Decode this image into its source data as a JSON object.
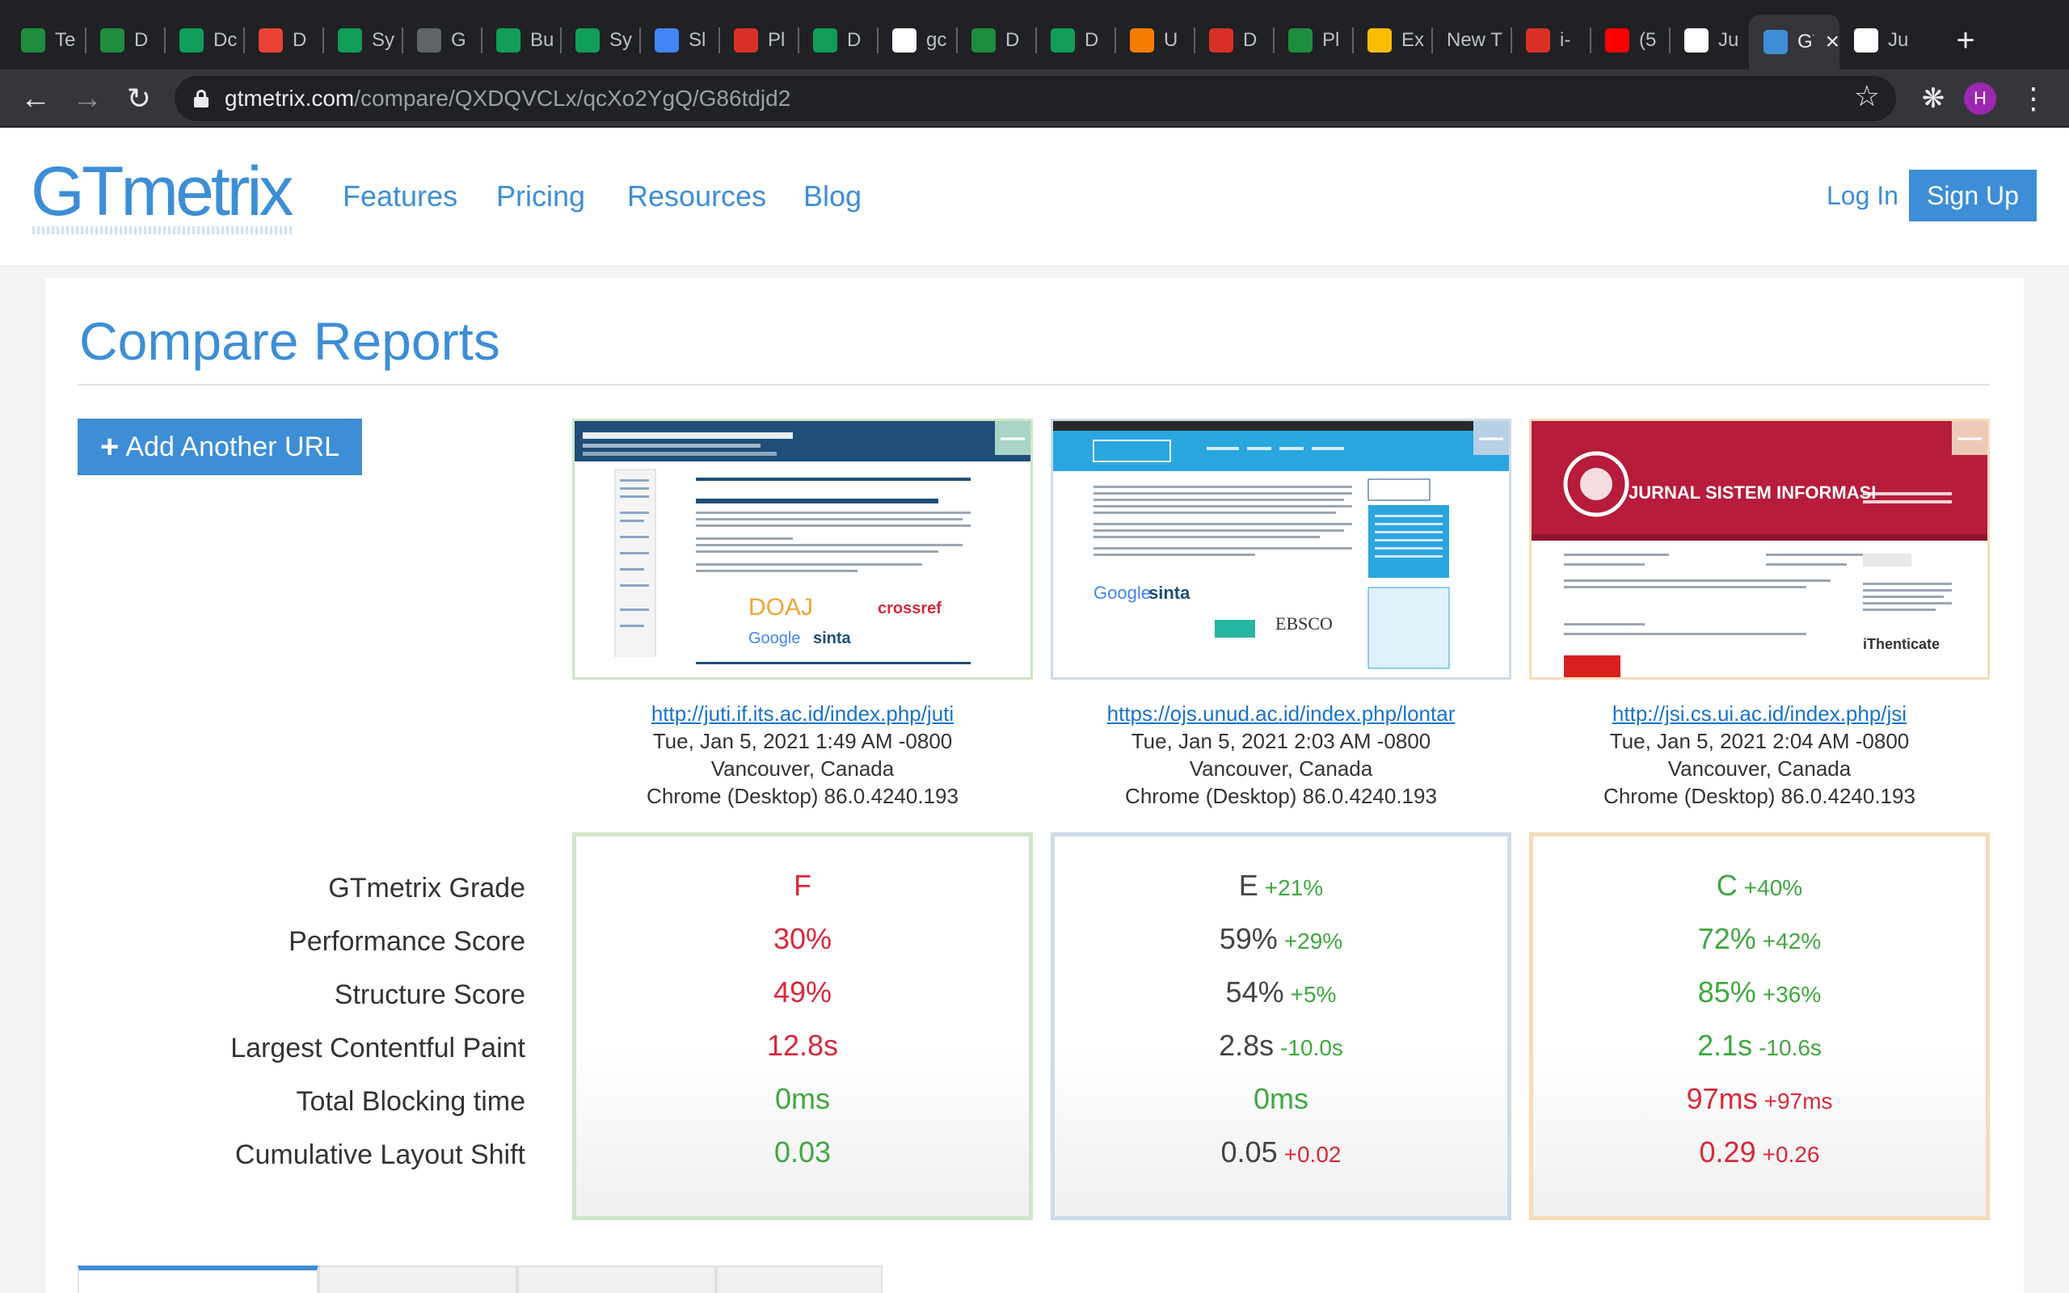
{
  "browser": {
    "tabs": [
      {
        "title": "Te",
        "icon": "google-drive-icon",
        "color": "#1e8e3e"
      },
      {
        "title": "D",
        "icon": "google-drive-icon",
        "color": "#1e8e3e"
      },
      {
        "title": "Dc",
        "icon": "google-sheets-icon",
        "color": "#0f9d58"
      },
      {
        "title": "D",
        "icon": "gmail-icon",
        "color": "#ea4335"
      },
      {
        "title": "Sy",
        "icon": "google-sheets-icon",
        "color": "#0f9d58"
      },
      {
        "title": "G",
        "icon": "globe-icon",
        "color": "#5f6368"
      },
      {
        "title": "Bu",
        "icon": "google-sheets-icon",
        "color": "#0f9d58"
      },
      {
        "title": "Sy",
        "icon": "google-sheets-icon",
        "color": "#0f9d58"
      },
      {
        "title": "Sl",
        "icon": "google-docs-icon",
        "color": "#4285f4"
      },
      {
        "title": "Pl",
        "icon": "red-gear-icon",
        "color": "#d93025"
      },
      {
        "title": "D",
        "icon": "google-sheets-icon",
        "color": "#0f9d58"
      },
      {
        "title": "gc",
        "icon": "google-icon",
        "color": "#ffffff"
      },
      {
        "title": "D",
        "icon": "google-drive-icon",
        "color": "#1e8e3e"
      },
      {
        "title": "D",
        "icon": "google-sheets-icon",
        "color": "#0f9d58"
      },
      {
        "title": "U",
        "icon": "orange-app-icon",
        "color": "#f57c00"
      },
      {
        "title": "D",
        "icon": "heart-icon",
        "color": "#d93025"
      },
      {
        "title": "Pl",
        "icon": "google-drive-icon",
        "color": "#1e8e3e"
      },
      {
        "title": "Ex",
        "icon": "colorful-grid-icon",
        "color": "#fbbc04"
      },
      {
        "title": "New T",
        "icon": "",
        "color": "#202124"
      },
      {
        "title": "i-",
        "icon": "red-square-icon",
        "color": "#d93025"
      },
      {
        "title": "(5",
        "icon": "youtube-icon",
        "color": "#ff0000"
      },
      {
        "title": "Ju",
        "icon": "white-square-icon",
        "color": "#ffffff"
      },
      {
        "title": "GT",
        "icon": "gtmetrix-icon",
        "color": "#3d8ed6",
        "active": true
      },
      {
        "title": "Ju",
        "icon": "pkp-icon",
        "color": "#ffffff"
      }
    ],
    "url_host": "gtmetrix.com",
    "url_path": "/compare/QXDQVCLx/qcXo2YgQ/G86tdjd2",
    "profile_initial": "H"
  },
  "header": {
    "logo": "GTmetrix",
    "nav": [
      "Features",
      "Pricing",
      "Resources",
      "Blog"
    ],
    "login": "Log In",
    "signup": "Sign Up"
  },
  "page": {
    "title": "Compare Reports",
    "add_url_label": "Add Another URL"
  },
  "metrics": [
    "GTmetrix Grade",
    "Performance Score",
    "Structure Score",
    "Largest Contentful Paint",
    "Total Blocking time",
    "Cumulative Layout Shift"
  ],
  "reports": [
    {
      "url": "http://juti.if.its.ac.id/index.php/juti",
      "date": "Tue, Jan 5, 2021 1:49 AM -0800",
      "location": "Vancouver, Canada",
      "browser": "Chrome (Desktop) 86.0.4240.193",
      "border_color": "#cfe6c8",
      "remove_bg": "#a8d5c8",
      "values": [
        {
          "value": "F",
          "color": "red",
          "delta": ""
        },
        {
          "value": "30%",
          "color": "red",
          "delta": ""
        },
        {
          "value": "49%",
          "color": "red",
          "delta": ""
        },
        {
          "value": "12.8s",
          "color": "red",
          "delta": ""
        },
        {
          "value": "0ms",
          "color": "green",
          "delta": ""
        },
        {
          "value": "0.03",
          "color": "green",
          "delta": ""
        }
      ]
    },
    {
      "url": "https://ojs.unud.ac.id/index.php/lontar",
      "date": "Tue, Jan 5, 2021 2:03 AM -0800",
      "location": "Vancouver, Canada",
      "browser": "Chrome (Desktop) 86.0.4240.193",
      "border_color": "#cddbea",
      "remove_bg": "#b8d0e6",
      "values": [
        {
          "value": "E",
          "color": "dark",
          "delta": "+21%",
          "delta_color": "green"
        },
        {
          "value": "59%",
          "color": "dark",
          "delta": "+29%",
          "delta_color": "green"
        },
        {
          "value": "54%",
          "color": "dark",
          "delta": "+5%",
          "delta_color": "green"
        },
        {
          "value": "2.8s",
          "color": "dark",
          "delta": "-10.0s",
          "delta_color": "green"
        },
        {
          "value": "0ms",
          "color": "green",
          "delta": ""
        },
        {
          "value": "0.05",
          "color": "dark",
          "delta": "+0.02",
          "delta_color": "red"
        }
      ]
    },
    {
      "url": "http://jsi.cs.ui.ac.id/index.php/jsi",
      "date": "Tue, Jan 5, 2021 2:04 AM -0800",
      "location": "Vancouver, Canada",
      "browser": "Chrome (Desktop) 86.0.4240.193",
      "border_color": "#f6dcb8",
      "remove_bg": "#efc9b8",
      "values": [
        {
          "value": "C",
          "color": "green",
          "delta": "+40%",
          "delta_color": "green"
        },
        {
          "value": "72%",
          "color": "green",
          "delta": "+42%",
          "delta_color": "green"
        },
        {
          "value": "85%",
          "color": "green",
          "delta": "+36%",
          "delta_color": "green"
        },
        {
          "value": "2.1s",
          "color": "green",
          "delta": "-10.6s",
          "delta_color": "green"
        },
        {
          "value": "97ms",
          "color": "red",
          "delta": "+97ms",
          "delta_color": "red"
        },
        {
          "value": "0.29",
          "color": "red",
          "delta": "+0.26",
          "delta_color": "red"
        }
      ]
    }
  ]
}
